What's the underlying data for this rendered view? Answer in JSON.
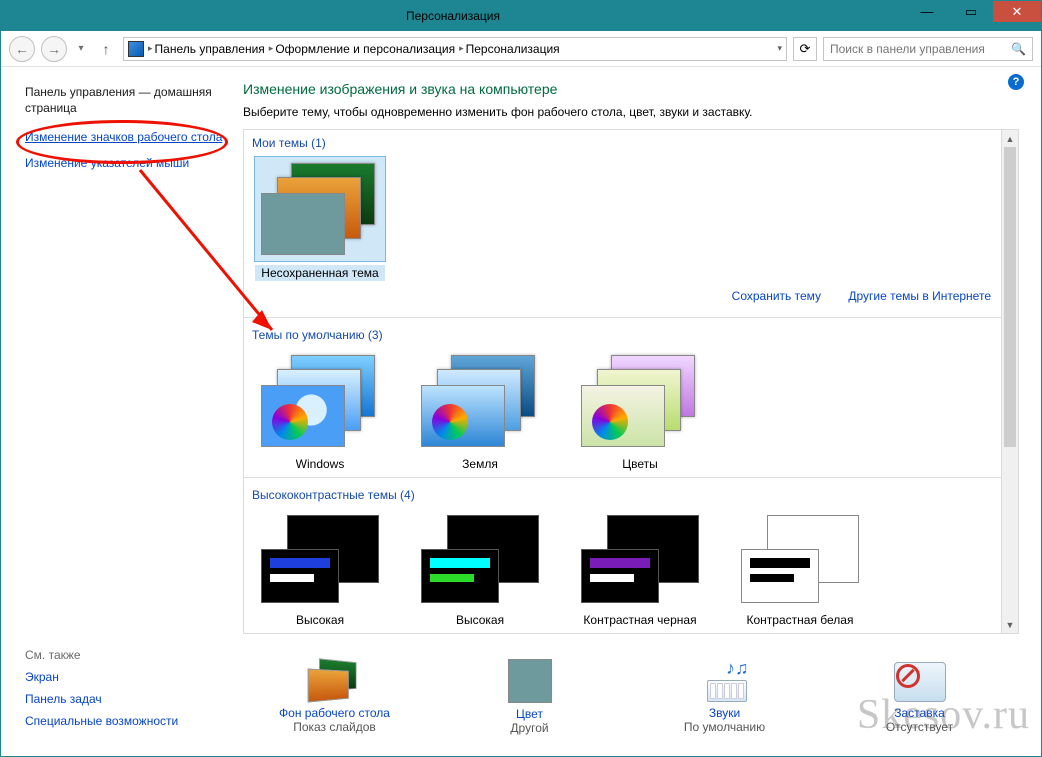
{
  "window": {
    "title": "Персонализация"
  },
  "breadcrumbs": {
    "root": "Панель управления",
    "mid": "Оформление и персонализация",
    "leaf": "Персонализация"
  },
  "search": {
    "placeholder": "Поиск в панели управления"
  },
  "sidebar": {
    "home": "Панель управления — домашняя страница",
    "links": [
      "Изменение значков рабочего стола",
      "Изменение указателей мыши"
    ]
  },
  "main": {
    "heading": "Изменение изображения и звука на компьютере",
    "desc": "Выберите тему, чтобы одновременно изменить фон рабочего стола, цвет, звуки и заставку.",
    "sections": {
      "my": {
        "head": "Мои темы (1)",
        "items": [
          "Несохраненная тема"
        ]
      },
      "default": {
        "head": "Темы по умолчанию (3)",
        "items": [
          "Windows",
          "Земля",
          "Цветы"
        ]
      },
      "hc": {
        "head": "Высококонтрастные темы (4)",
        "items": [
          "Высокая",
          "Высокая",
          "Контрастная черная",
          "Контрастная белая"
        ]
      }
    },
    "actions": {
      "save": "Сохранить тему",
      "more": "Другие темы в Интернете"
    }
  },
  "bottom_left": {
    "label": "См. также",
    "links": [
      "Экран",
      "Панель задач",
      "Специальные возможности"
    ]
  },
  "bottom_right": {
    "bg": {
      "label": "Фон рабочего стола",
      "value": "Показ слайдов"
    },
    "color": {
      "label": "Цвет",
      "value": "Другой"
    },
    "sound": {
      "label": "Звуки",
      "value": "По умолчанию"
    },
    "saver": {
      "label": "Заставка",
      "value": "Отсутствует"
    }
  },
  "watermark": "Skesov.ru",
  "icons": {
    "back": "←",
    "fwd": "→",
    "down": "▾",
    "up": "↑",
    "crumb": "▸",
    "refresh": "⟳",
    "search": "🔍",
    "help": "?",
    "min": "—",
    "max": "▭",
    "close": "✕",
    "tri_up": "▲",
    "tri_dn": "▼"
  }
}
